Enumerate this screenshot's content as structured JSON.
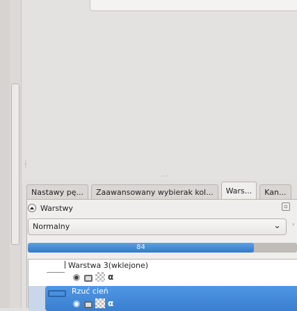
{
  "tabs": [
    {
      "label": "Nastawy pę..."
    },
    {
      "label": "Zaawansowany wybierak kol..."
    },
    {
      "label": "Wars..."
    },
    {
      "label": "Kan..."
    }
  ],
  "panel": {
    "title": "Warstwy"
  },
  "blend_mode": {
    "value": "Normalny"
  },
  "opacity": {
    "value": "84",
    "fraction": 0.84
  },
  "layers": [
    {
      "name": "Warstwa 3(wklejone)",
      "selected": false
    },
    {
      "name": "Rzuć cień",
      "selected": true
    }
  ],
  "colors": {
    "accent": "#3a7fd0",
    "selection": "#4f97e4"
  },
  "icons": {
    "visibility": "eye-icon",
    "lock": "lock-icon",
    "alpha": "alpha-lock-icon",
    "inherit": "inherit-alpha-icon",
    "collapse": "collapse-icon",
    "config": "panel-config-icon",
    "dropdown": "chevron-down-icon"
  }
}
